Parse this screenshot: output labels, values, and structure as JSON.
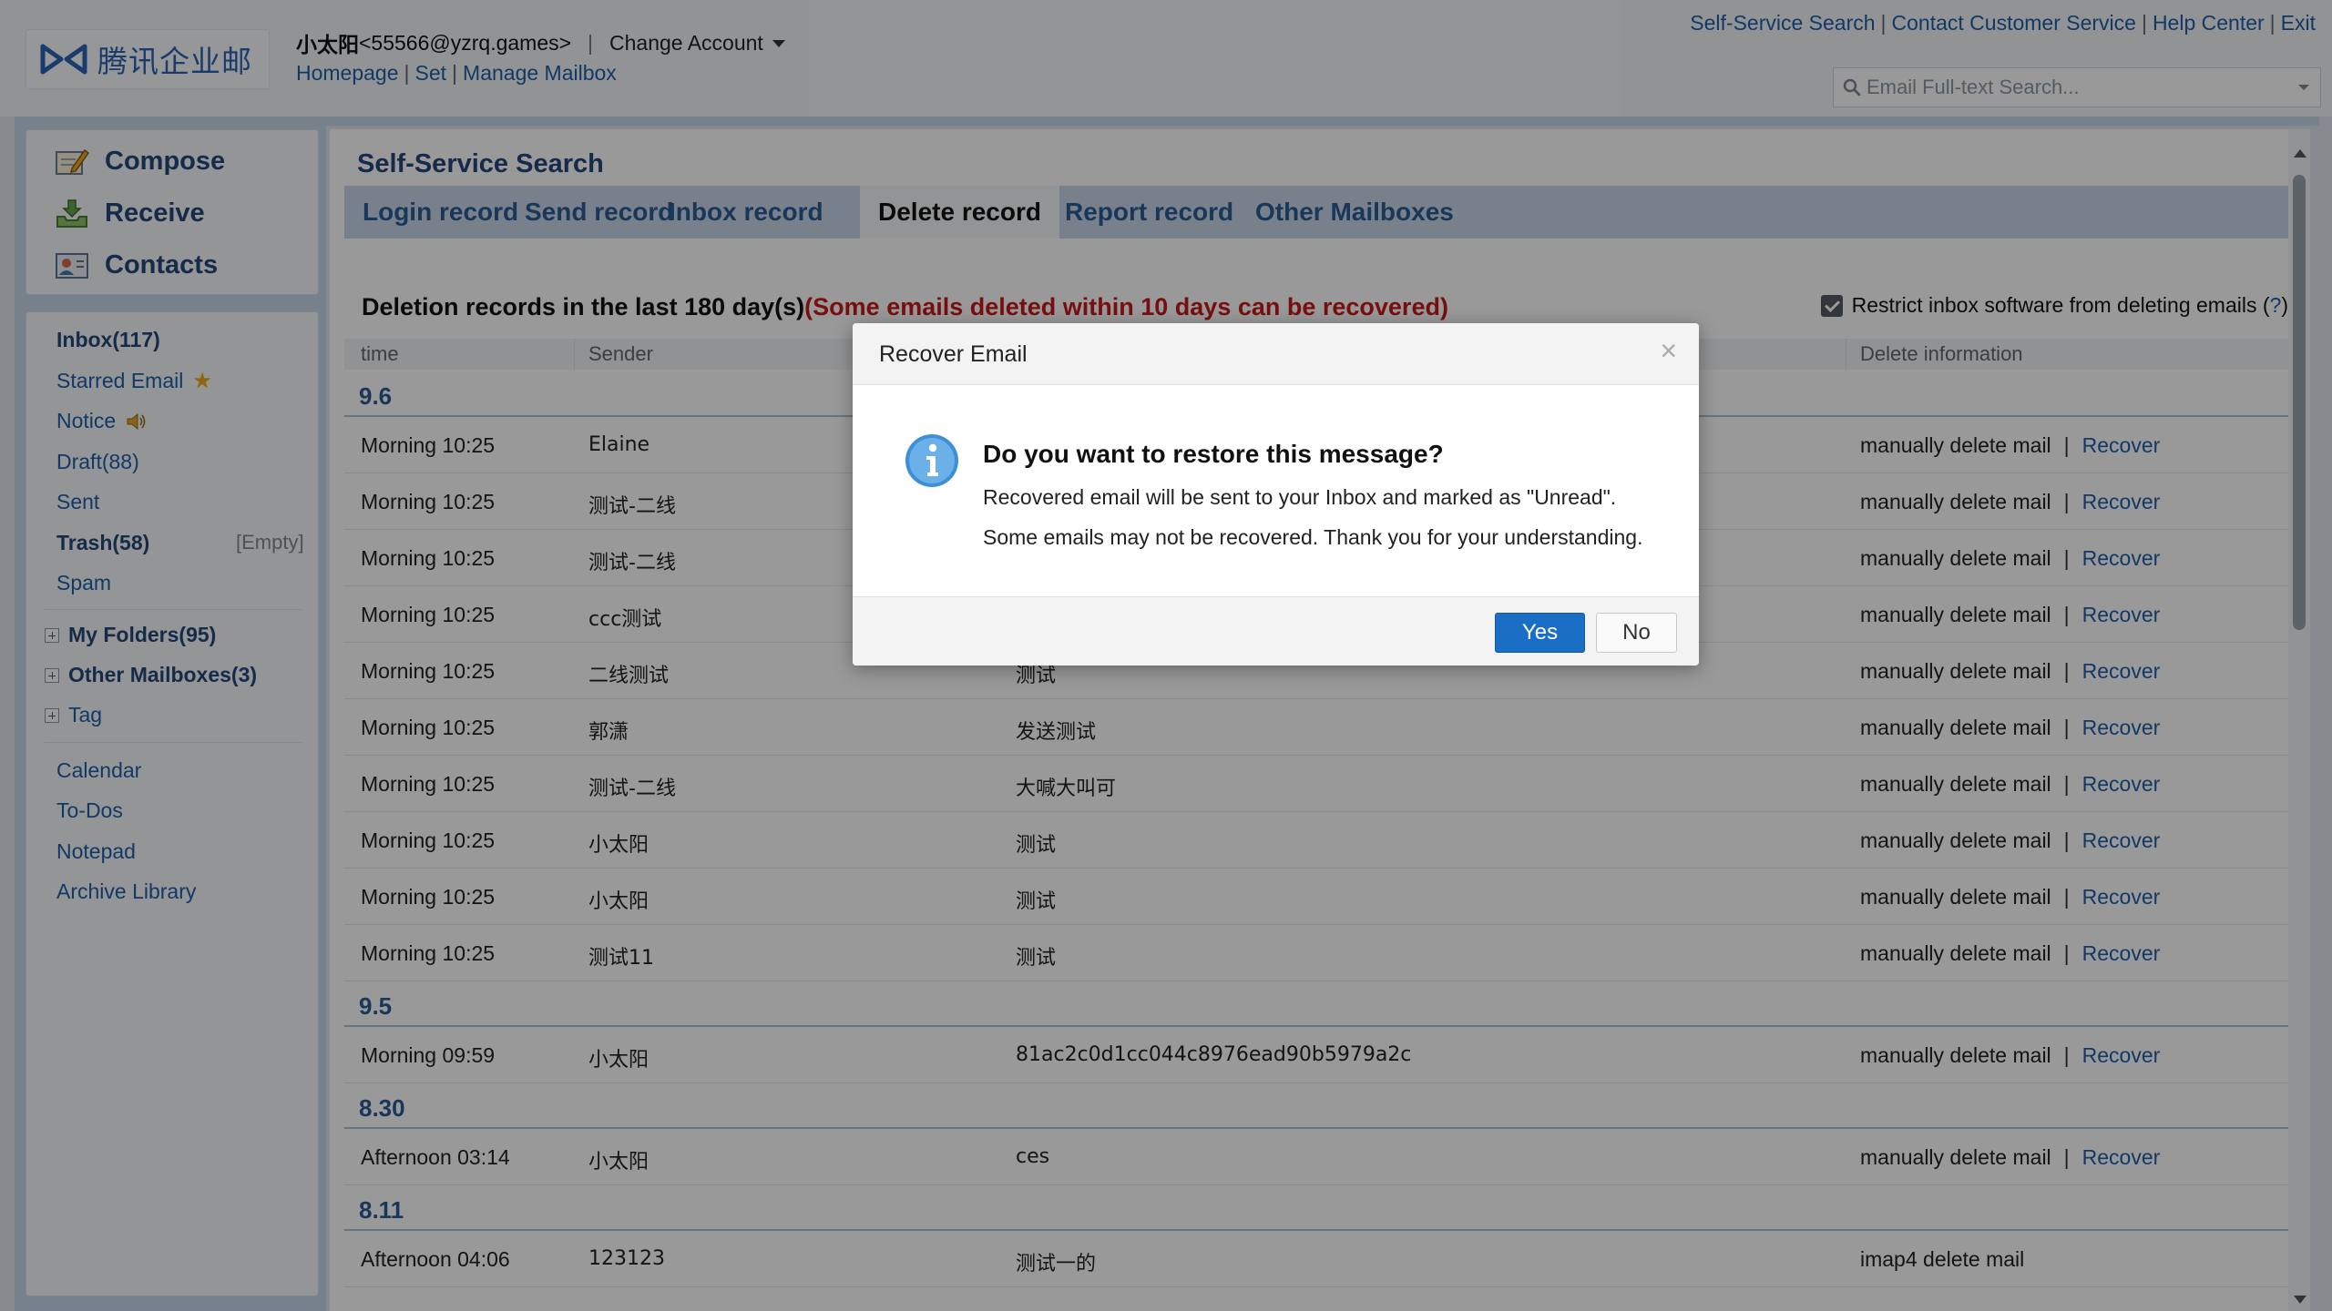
{
  "header": {
    "logo_text": "腾讯企业邮",
    "account_name": "小太阳",
    "account_email": "<55566@yzrq.games>",
    "account_sep": "|",
    "change_account": "Change Account",
    "subnav": [
      "Homepage",
      "Set",
      "Manage Mailbox"
    ],
    "top_links": [
      "Self-Service Search",
      "Contact Customer Service",
      "Help Center",
      "Exit"
    ],
    "search_placeholder": "Email Full-text Search..."
  },
  "sidebar": {
    "quick": [
      {
        "label": "Compose",
        "icon": "compose-icon"
      },
      {
        "label": "Receive",
        "icon": "receive-icon"
      },
      {
        "label": "Contacts",
        "icon": "contacts-icon"
      }
    ],
    "folders": {
      "inbox": "Inbox(117)",
      "starred": "Starred Email",
      "notice": "Notice",
      "draft": "Draft(88)",
      "sent": "Sent",
      "trash": "Trash(58)",
      "empty": "[Empty]",
      "spam": "Spam",
      "my_folders": "My Folders(95)",
      "other_mailboxes": "Other Mailboxes(3)",
      "tag": "Tag"
    },
    "tools": [
      "Calendar",
      "To-Dos",
      "Notepad",
      "Archive Library"
    ]
  },
  "main": {
    "title": "Self-Service Search",
    "tabs": [
      "Login record",
      "Send record",
      "Inbox record",
      "Delete record",
      "Report record",
      "Other Mailboxes"
    ],
    "active_tab": "Delete record",
    "section_title": "Deletion records in the last 180 day(s)",
    "section_warning": "(Some emails deleted within 10 days can be recovered)",
    "restrict_label": "Restrict inbox software from deleting emails (",
    "restrict_q": "?",
    "restrict_close": ")",
    "columns": {
      "time": "time",
      "sender": "Sender",
      "info": "Delete information"
    },
    "groups": [
      {
        "date": "9.6",
        "rows": [
          {
            "time": "Morning 10:25",
            "sender": "Elaine",
            "subject": "",
            "info": "manually delete mail",
            "action": "Recover"
          },
          {
            "time": "Morning 10:25",
            "sender": "测试-二线",
            "subject": "",
            "info": "manually delete mail",
            "action": "Recover"
          },
          {
            "time": "Morning 10:25",
            "sender": "测试-二线",
            "subject": "",
            "info": "manually delete mail",
            "action": "Recover"
          },
          {
            "time": "Morning 10:25",
            "sender": "ccc测试",
            "subject": "",
            "info": "manually delete mail",
            "action": "Recover"
          },
          {
            "time": "Morning 10:25",
            "sender": "二线测试",
            "subject": "测试",
            "info": "manually delete mail",
            "action": "Recover"
          },
          {
            "time": "Morning 10:25",
            "sender": "郭潇",
            "subject": "发送测试",
            "info": "manually delete mail",
            "action": "Recover"
          },
          {
            "time": "Morning 10:25",
            "sender": "测试-二线",
            "subject": "大喊大叫可",
            "info": "manually delete mail",
            "action": "Recover"
          },
          {
            "time": "Morning 10:25",
            "sender": "小太阳",
            "subject": "测试",
            "info": "manually delete mail",
            "action": "Recover"
          },
          {
            "time": "Morning 10:25",
            "sender": "小太阳",
            "subject": "测试",
            "info": "manually delete mail",
            "action": "Recover"
          },
          {
            "time": "Morning 10:25",
            "sender": "测试11",
            "subject": "测试",
            "info": "manually delete mail",
            "action": "Recover"
          }
        ]
      },
      {
        "date": "9.5",
        "rows": [
          {
            "time": "Morning 09:59",
            "sender": "小太阳",
            "subject": "81ac2c0d1cc044c8976ead90b5979a2c",
            "info": "manually delete mail",
            "action": "Recover"
          }
        ]
      },
      {
        "date": "8.30",
        "rows": [
          {
            "time": "Afternoon 03:14",
            "sender": "小太阳",
            "subject": "ces",
            "info": "manually delete mail",
            "action": "Recover"
          }
        ]
      },
      {
        "date": "8.11",
        "rows": [
          {
            "time": "Afternoon 04:06",
            "sender": "123123",
            "subject": "测试一的",
            "info": "imap4 delete mail",
            "action": ""
          }
        ]
      }
    ]
  },
  "modal": {
    "title": "Recover Email",
    "close": "×",
    "question": "Do you want to restore this message?",
    "line1": "Recovered email will be sent to your Inbox and marked as \"Unread\".",
    "line2": "Some emails may not be recovered. Thank you for your understanding.",
    "yes": "Yes",
    "no": "No"
  },
  "colors": {
    "accent_blue": "#1f5fa8",
    "title_blue": "#23497a",
    "warning_red": "#c81a1a",
    "button_blue": "#1a6ec6"
  }
}
